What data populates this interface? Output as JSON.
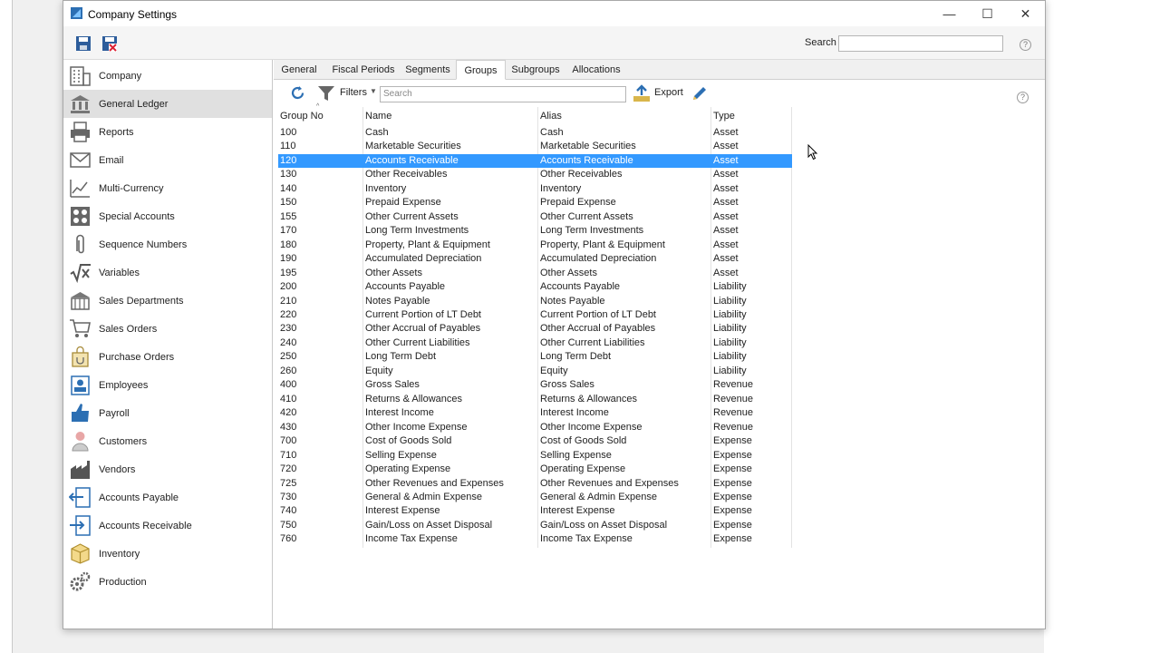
{
  "window": {
    "title": "Company Settings"
  },
  "toolbar": {
    "search_label": "Search"
  },
  "sidebar": {
    "items": [
      {
        "label": "Company",
        "icon": "building-icon"
      },
      {
        "label": "General Ledger",
        "icon": "bank-icon"
      },
      {
        "label": "Reports",
        "icon": "printer-icon"
      },
      {
        "label": "Email",
        "icon": "envelope-icon"
      },
      {
        "label": "Multi-Currency",
        "icon": "currency-chart-icon"
      },
      {
        "label": "Special Accounts",
        "icon": "grid-accounts-icon"
      },
      {
        "label": "Sequence Numbers",
        "icon": "paperclip-icon"
      },
      {
        "label": "Variables",
        "icon": "sqrt-x-icon"
      },
      {
        "label": "Sales Departments",
        "icon": "store-icon"
      },
      {
        "label": "Sales Orders",
        "icon": "cart-icon"
      },
      {
        "label": "Purchase Orders",
        "icon": "bag-icon"
      },
      {
        "label": "Employees",
        "icon": "id-card-icon"
      },
      {
        "label": "Payroll",
        "icon": "thumbs-up-icon"
      },
      {
        "label": "Customers",
        "icon": "person-icon"
      },
      {
        "label": "Vendors",
        "icon": "factory-icon"
      },
      {
        "label": "Accounts Payable",
        "icon": "export-doc-icon"
      },
      {
        "label": "Accounts Receivable",
        "icon": "import-doc-icon"
      },
      {
        "label": "Inventory",
        "icon": "box-icon"
      },
      {
        "label": "Production",
        "icon": "gears-icon"
      }
    ]
  },
  "tabs": [
    "General",
    "Fiscal Periods",
    "Segments",
    "Groups",
    "Subgroups",
    "Allocations"
  ],
  "gridbar": {
    "filters_label": "Filters",
    "search_placeholder": "Search",
    "export_label": "Export"
  },
  "grid": {
    "columns": [
      "Group No",
      "Name",
      "Alias",
      "Type"
    ],
    "rows": [
      [
        "100",
        "Cash",
        "Cash",
        "Asset"
      ],
      [
        "110",
        "Marketable Securities",
        "Marketable Securities",
        "Asset"
      ],
      [
        "120",
        "Accounts Receivable",
        "Accounts Receivable",
        "Asset"
      ],
      [
        "130",
        "Other Receivables",
        "Other Receivables",
        "Asset"
      ],
      [
        "140",
        "Inventory",
        "Inventory",
        "Asset"
      ],
      [
        "150",
        "Prepaid Expense",
        "Prepaid Expense",
        "Asset"
      ],
      [
        "155",
        "Other Current Assets",
        "Other Current Assets",
        "Asset"
      ],
      [
        "170",
        "Long Term Investments",
        "Long Term Investments",
        "Asset"
      ],
      [
        "180",
        "Property, Plant & Equipment",
        "Property, Plant & Equipment",
        "Asset"
      ],
      [
        "190",
        "Accumulated Depreciation",
        "Accumulated Depreciation",
        "Asset"
      ],
      [
        "195",
        "Other Assets",
        "Other Assets",
        "Asset"
      ],
      [
        "200",
        "Accounts Payable",
        "Accounts Payable",
        "Liability"
      ],
      [
        "210",
        "Notes Payable",
        "Notes Payable",
        "Liability"
      ],
      [
        "220",
        "Current Portion of LT Debt",
        "Current Portion of LT Debt",
        "Liability"
      ],
      [
        "230",
        "Other Accrual of Payables",
        "Other Accrual of Payables",
        "Liability"
      ],
      [
        "240",
        "Other Current Liabilities",
        "Other Current Liabilities",
        "Liability"
      ],
      [
        "250",
        "Long Term Debt",
        "Long Term Debt",
        "Liability"
      ],
      [
        "260",
        "Equity",
        "Equity",
        "Liability"
      ],
      [
        "400",
        "Gross Sales",
        "Gross Sales",
        "Revenue"
      ],
      [
        "410",
        "Returns & Allowances",
        "Returns & Allowances",
        "Revenue"
      ],
      [
        "420",
        "Interest Income",
        "Interest Income",
        "Revenue"
      ],
      [
        "430",
        "Other Income Expense",
        "Other Income Expense",
        "Revenue"
      ],
      [
        "700",
        "Cost of Goods Sold",
        "Cost of Goods Sold",
        "Expense"
      ],
      [
        "710",
        "Selling Expense",
        "Selling Expense",
        "Expense"
      ],
      [
        "720",
        "Operating Expense",
        "Operating Expense",
        "Expense"
      ],
      [
        "725",
        "Other Revenues and Expenses",
        "Other Revenues and Expenses",
        "Expense"
      ],
      [
        "730",
        "General & Admin Expense",
        "General & Admin Expense",
        "Expense"
      ],
      [
        "740",
        "Interest Expense",
        "Interest Expense",
        "Expense"
      ],
      [
        "750",
        "Gain/Loss on Asset Disposal",
        "Gain/Loss on Asset Disposal",
        "Expense"
      ],
      [
        "760",
        "Income Tax Expense",
        "Income Tax Expense",
        "Expense"
      ]
    ]
  }
}
